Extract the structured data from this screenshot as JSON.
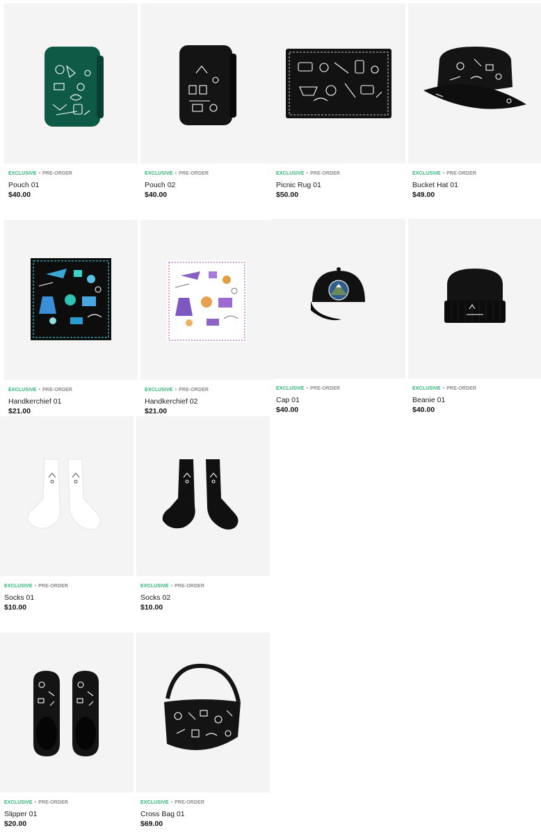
{
  "badges": {
    "exclusive": "EXCLUSIVE",
    "separator": "•",
    "preorder": "PRE-ORDER"
  },
  "colors": {
    "exclusive": "#2bb673",
    "preorder": "#8a8a8a",
    "thumb_bg": "#f4f4f4"
  },
  "products": [
    {
      "name": "Pouch 01",
      "price": "$40.00",
      "image": "green-pouch-icon"
    },
    {
      "name": "Pouch 02",
      "price": "$40.00",
      "image": "black-pouch-icon"
    },
    {
      "name": "Picnic Rug 01",
      "price": "$50.00",
      "image": "picnic-rug-icon"
    },
    {
      "name": "Bucket Hat 01",
      "price": "$49.00",
      "image": "bucket-hat-icon"
    },
    {
      "name": "Handkerchief 01",
      "price": "$21.00",
      "image": "dark-handkerchief-icon"
    },
    {
      "name": "Handkerchief 02",
      "price": "$21.00",
      "image": "white-handkerchief-icon"
    },
    {
      "name": "Cap 01",
      "price": "$40.00",
      "image": "cap-icon"
    },
    {
      "name": "Beanie 01",
      "price": "$40.00",
      "image": "beanie-icon"
    },
    {
      "name": "Socks 01",
      "price": "$10.00",
      "image": "white-socks-icon"
    },
    {
      "name": "Socks 02",
      "price": "$10.00",
      "image": "black-socks-icon"
    },
    {
      "name": "Slipper 01",
      "price": "$20.00",
      "image": "slippers-icon"
    },
    {
      "name": "Cross Bag 01",
      "price": "$69.00",
      "image": "cross-bag-icon"
    }
  ]
}
